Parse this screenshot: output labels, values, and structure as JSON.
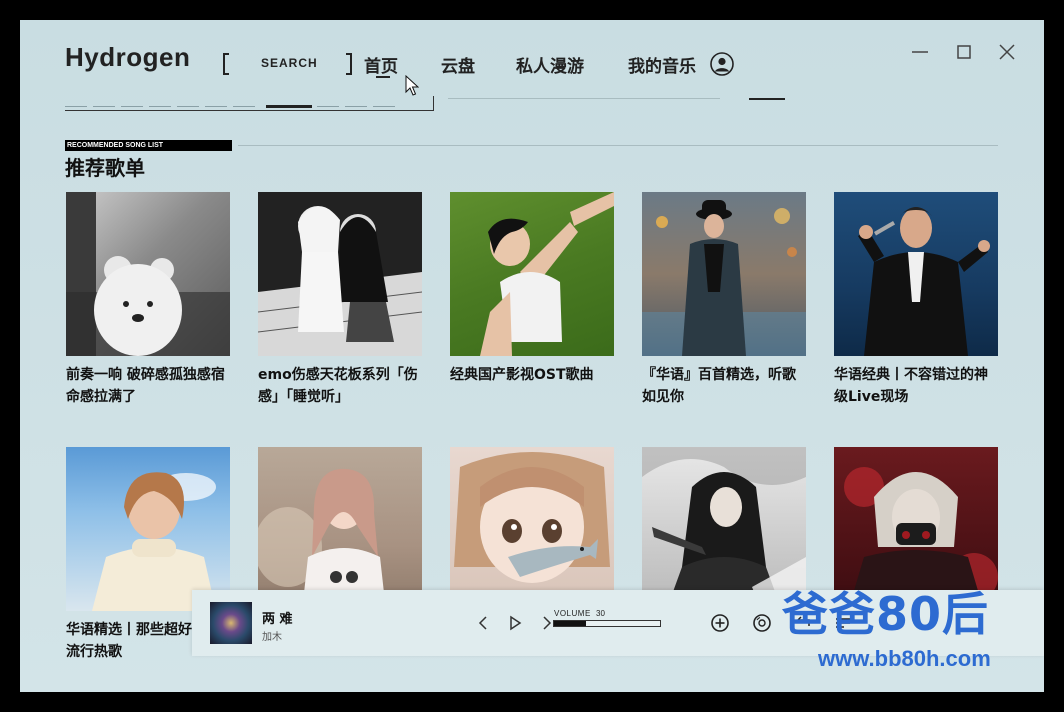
{
  "app": {
    "brand": "Hydrogen"
  },
  "nav": {
    "search_label": "SEARCH",
    "items": [
      {
        "label": "首页",
        "active": true
      },
      {
        "label": "云盘"
      },
      {
        "label": "私人漫游"
      },
      {
        "label": "我的音乐"
      }
    ]
  },
  "section": {
    "tag": "RECOMMENDED SONG LIST",
    "title": "推荐歌单"
  },
  "playlists": [
    {
      "title": "前奏一响 破碎感孤独感宿命感拉满了"
    },
    {
      "title": "emo伤感天花板系列「伤感」「睡觉听」"
    },
    {
      "title": "经典国产影视OST歌曲"
    },
    {
      "title": "『华语』百首精选，听歌如见你"
    },
    {
      "title": "华语经典丨不容错过的神级Live现场"
    },
    {
      "title": "华语精选丨那些超好听的流行热歌"
    },
    {
      "title": ""
    },
    {
      "title": ""
    },
    {
      "title": ""
    },
    {
      "title": ""
    }
  ],
  "player": {
    "song_title": "两 难",
    "artist": "加木",
    "volume_label": "VOLUME",
    "volume_value": "30",
    "volume_fraction": 0.3
  },
  "watermark": {
    "text_cn": "爸爸80后",
    "url": "www.bb80h.com"
  },
  "colors": {
    "background": "#cfe1e5",
    "text": "#111111",
    "player_bg": "#e0ecee",
    "watermark": "#2d6bd1"
  }
}
